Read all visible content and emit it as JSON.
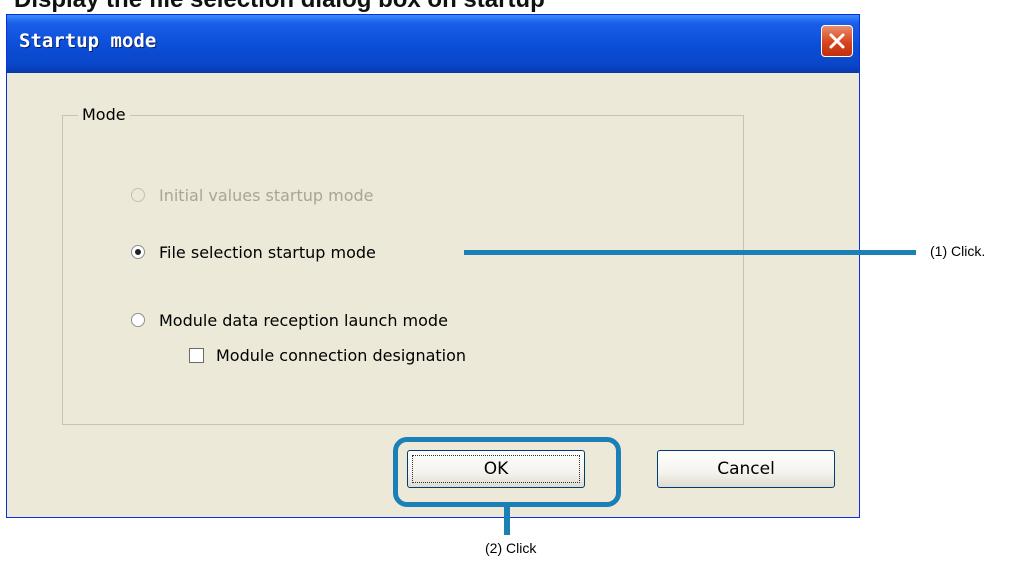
{
  "header_text": "Display the file selection dialog box on startup",
  "dialog": {
    "title": "Startup mode",
    "group_label": "Mode",
    "options": [
      {
        "label": "Initial values startup mode",
        "selected": false,
        "enabled": false
      },
      {
        "label": "File selection startup mode",
        "selected": true,
        "enabled": true
      },
      {
        "label": "Module data reception launch mode",
        "selected": false,
        "enabled": true
      }
    ],
    "checkbox": {
      "label": "Module connection designation",
      "checked": false
    },
    "ok_label": "OK",
    "cancel_label": "Cancel"
  },
  "callouts": {
    "step1": "(1) Click.",
    "step2": "(2) Click"
  },
  "colors": {
    "callout": "#1a80b6",
    "titlebar": "#0c4fd8",
    "close_button": "#d8441c",
    "dialog_bg": "#ece9d8"
  },
  "icons": [
    "close-icon",
    "radio-selected-icon",
    "radio-unselected-icon",
    "checkbox-icon"
  ]
}
